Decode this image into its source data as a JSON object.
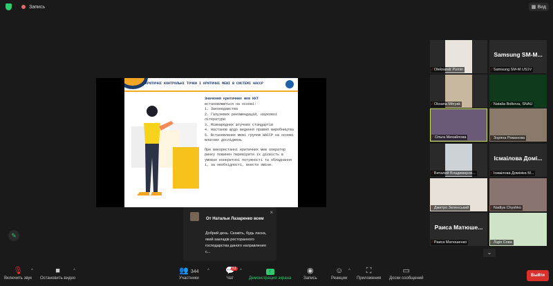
{
  "topbar": {
    "recording": "Запись",
    "view": "Вид"
  },
  "slide": {
    "title": "КРИТИЧНІ КОНТРОЛЬНІ ТОЧКИ І КРИТИЧНІ МЕЖІ В СИСТЕМІ НАССР",
    "heading": "Значення критичних меж ККТ",
    "intro": "встановлюються на основі:",
    "items": [
      "1. Законодавства",
      "2. Галузевих рекомендацій, наукової літератури",
      "3. Міжнародних штучних стандартів",
      "4. Настанов щодо ведення правил виробництва",
      "5. Встановлених межі групою НАССР на основі власних досліджень"
    ],
    "footer": "При використанні критичних меж оператор ринку повинен перевірити їх дієвість в умовах конкретної потужності та обладнання і, за необхідності, внести зміни."
  },
  "chat_popup": {
    "from": "От Натальи Лазаренко всем",
    "message": "Добрий день. Скажіть, будь ласка, який закладів ресторанного господарства даного направления  с..."
  },
  "participants": [
    {
      "name": "Oleksandr Pomin",
      "big": ""
    },
    {
      "name": "Samsung SM-M US1V",
      "big": "Samsung  SM-M..."
    },
    {
      "name": "Oksana Mitryak",
      "big": ""
    },
    {
      "name": "Natalia Bolkova, SNAU",
      "big": ""
    },
    {
      "name": "Ольга Михайлова",
      "big": ""
    },
    {
      "name": "Зоряна Романова",
      "big": ""
    },
    {
      "name": "Виталий Владимиров...",
      "big": ""
    },
    {
      "name": "Ісмаілова Домініка М...",
      "big": "Ісмаілова  Домі..."
    },
    {
      "name": "Дмитро Зеленський",
      "big": ""
    },
    {
      "name": "Nadiya Chyshko",
      "big": ""
    },
    {
      "name": "Раиса Матюшенко",
      "big": "Раиса  Матюше..."
    },
    {
      "name": "Лідія Сова",
      "big": ""
    }
  ],
  "toolbar": {
    "unmute": "Включить звук",
    "stop_video": "Остановить видео",
    "participants": "Участники",
    "participants_count": "344",
    "chat": "Чат",
    "chat_badge": "53",
    "share": "Демонстрация экрана",
    "record": "Запись",
    "reactions": "Реакции",
    "apps": "Приложения",
    "whiteboards": "Доски сообщений",
    "leave": "Выйти"
  },
  "colors": {
    "accent_green": "#2ecc71",
    "leave_red": "#d9302c",
    "slide_orange": "#f5a623",
    "slide_navy": "#1d3b6b"
  }
}
